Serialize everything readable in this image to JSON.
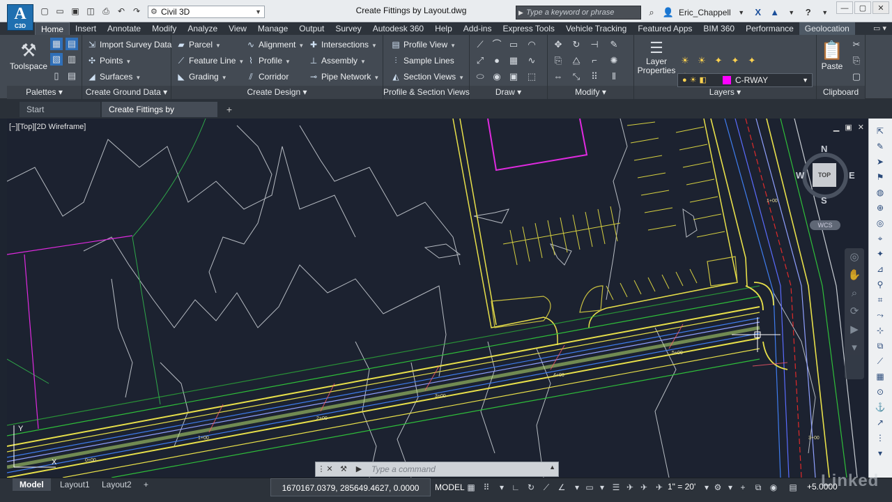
{
  "app": {
    "logo_big": "A",
    "logo_small": "C3D",
    "doc_title": "Create Fittings by Layout.dwg",
    "workspace": "Civil 3D",
    "search_placeholder": "Type a keyword or phrase",
    "user": "Eric_Chappell"
  },
  "quick_access": [
    "new-icon",
    "open-icon",
    "save-icon",
    "save-as-icon",
    "print-icon",
    "undo-icon",
    "redo-icon"
  ],
  "ribbon_tabs": [
    "Home",
    "Insert",
    "Annotate",
    "Modify",
    "Analyze",
    "View",
    "Manage",
    "Output",
    "Survey",
    "Autodesk 360",
    "Help",
    "Add-ins",
    "Express Tools",
    "Vehicle Tracking",
    "Featured Apps",
    "BIM 360",
    "Performance",
    "Geolocation"
  ],
  "active_tab": "Home",
  "panels": {
    "palettes": {
      "title": "Palettes",
      "toolspace": "Toolspace"
    },
    "ground": {
      "title": "Create Ground Data",
      "items": [
        "Import Survey Data",
        "Points",
        "Surfaces"
      ]
    },
    "design": {
      "title": "Create Design",
      "items": [
        "Parcel",
        "Feature Line",
        "Grading",
        "Alignment",
        "Profile",
        "Corridor",
        "Intersections",
        "Assembly",
        "Pipe Network"
      ]
    },
    "profile": {
      "title": "Profile & Section Views",
      "items": [
        "Profile View",
        "Sample Lines",
        "Section Views"
      ]
    },
    "draw": {
      "title": "Draw"
    },
    "modify": {
      "title": "Modify"
    },
    "layers": {
      "title": "Layers",
      "layer_properties": "Layer Properties",
      "current_layer": "C-RWAY",
      "layer_color": "#ff00ff"
    },
    "clipboard": {
      "title": "Clipboard",
      "paste": "Paste"
    }
  },
  "file_tabs": [
    "Start",
    "Create Fittings by Layout*"
  ],
  "viewport": {
    "label": "[−][Top][2D Wireframe]",
    "cube": {
      "n": "N",
      "s": "S",
      "e": "E",
      "w": "W",
      "top": "TOP",
      "wcs": "WCS"
    },
    "station_labels": [
      "3+00",
      "4+00",
      "5+00",
      "6+00",
      "2+00",
      "1+00",
      "0+00",
      "1+00",
      "2+00",
      "3+00"
    ]
  },
  "command": {
    "placeholder": "Type a command"
  },
  "status": {
    "layout_tabs": [
      "Model",
      "Layout1",
      "Layout2"
    ],
    "coords": "1670167.0379, 285649.4627, 0.0000",
    "model": "MODEL",
    "scale": "1\" = 20'",
    "elevation": "+5.0000"
  },
  "watermark": "Linked",
  "colors": {
    "background": "#1c2230",
    "ribbon": "#434a53",
    "accent_magenta": "#ff00ff",
    "road_yellow": "#e8e04a",
    "contour_white": "#c8cdd3"
  }
}
